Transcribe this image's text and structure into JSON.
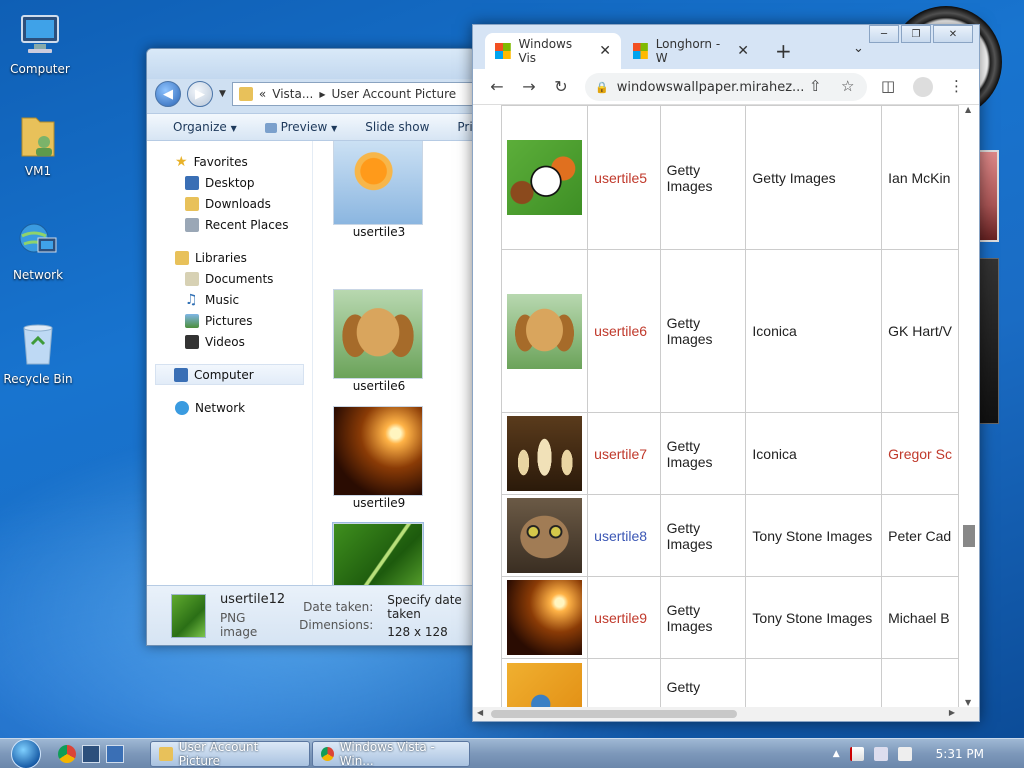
{
  "desktop": {
    "icons": [
      {
        "label": "Computer"
      },
      {
        "label": "VM1"
      },
      {
        "label": "Network"
      },
      {
        "label": "Recycle Bin"
      }
    ]
  },
  "explorer": {
    "breadcrumb_root": "«",
    "breadcrumb": [
      "Vista...",
      "User Account Picture"
    ],
    "toolbar": {
      "organize": "Organize",
      "preview": "Preview",
      "slideshow": "Slide show",
      "print": "Pri"
    },
    "nav": {
      "favorites": "Favorites",
      "desktop": "Desktop",
      "downloads": "Downloads",
      "recent": "Recent Places",
      "libraries": "Libraries",
      "documents": "Documents",
      "music": "Music",
      "pictures": "Pictures",
      "videos": "Videos",
      "computer": "Computer",
      "network": "Network"
    },
    "files": [
      {
        "name": "usertile3"
      },
      {
        "name": "usertile6"
      },
      {
        "name": "usertile9"
      },
      {
        "name": "usertile12"
      }
    ],
    "details": {
      "name": "usertile12",
      "type": "PNG image",
      "date_label": "Date taken:",
      "date_value": "Specify date taken",
      "dim_label": "Dimensions:",
      "dim_value": "128 x 128"
    }
  },
  "browser": {
    "tabs": [
      {
        "title": "Windows Vis"
      },
      {
        "title": "Longhorn - W"
      }
    ],
    "url": "windowswallpaper.mirahez...",
    "rows": [
      {
        "name": "usertile5",
        "source": "Getty Images",
        "collection": "Getty Images",
        "author": "Ian McKin"
      },
      {
        "name": "usertile6",
        "source": "Getty Images",
        "collection": "Iconica",
        "author": "GK Hart/V"
      },
      {
        "name": "usertile7",
        "source": "Getty Images",
        "collection": "Iconica",
        "author": "Gregor Sc"
      },
      {
        "name": "usertile8",
        "source": "Getty Images",
        "collection": "Tony Stone Images",
        "author": "Peter Cad"
      },
      {
        "name": "usertile9",
        "source": "Getty Images",
        "collection": "Tony Stone Images",
        "author": "Michael B"
      },
      {
        "name": "",
        "source": "Getty",
        "collection": "",
        "author": ""
      }
    ]
  },
  "taskbar": {
    "explorer_task": "User Account Picture",
    "browser_task": "Windows Vista - Win...",
    "time": "5:31 PM"
  }
}
